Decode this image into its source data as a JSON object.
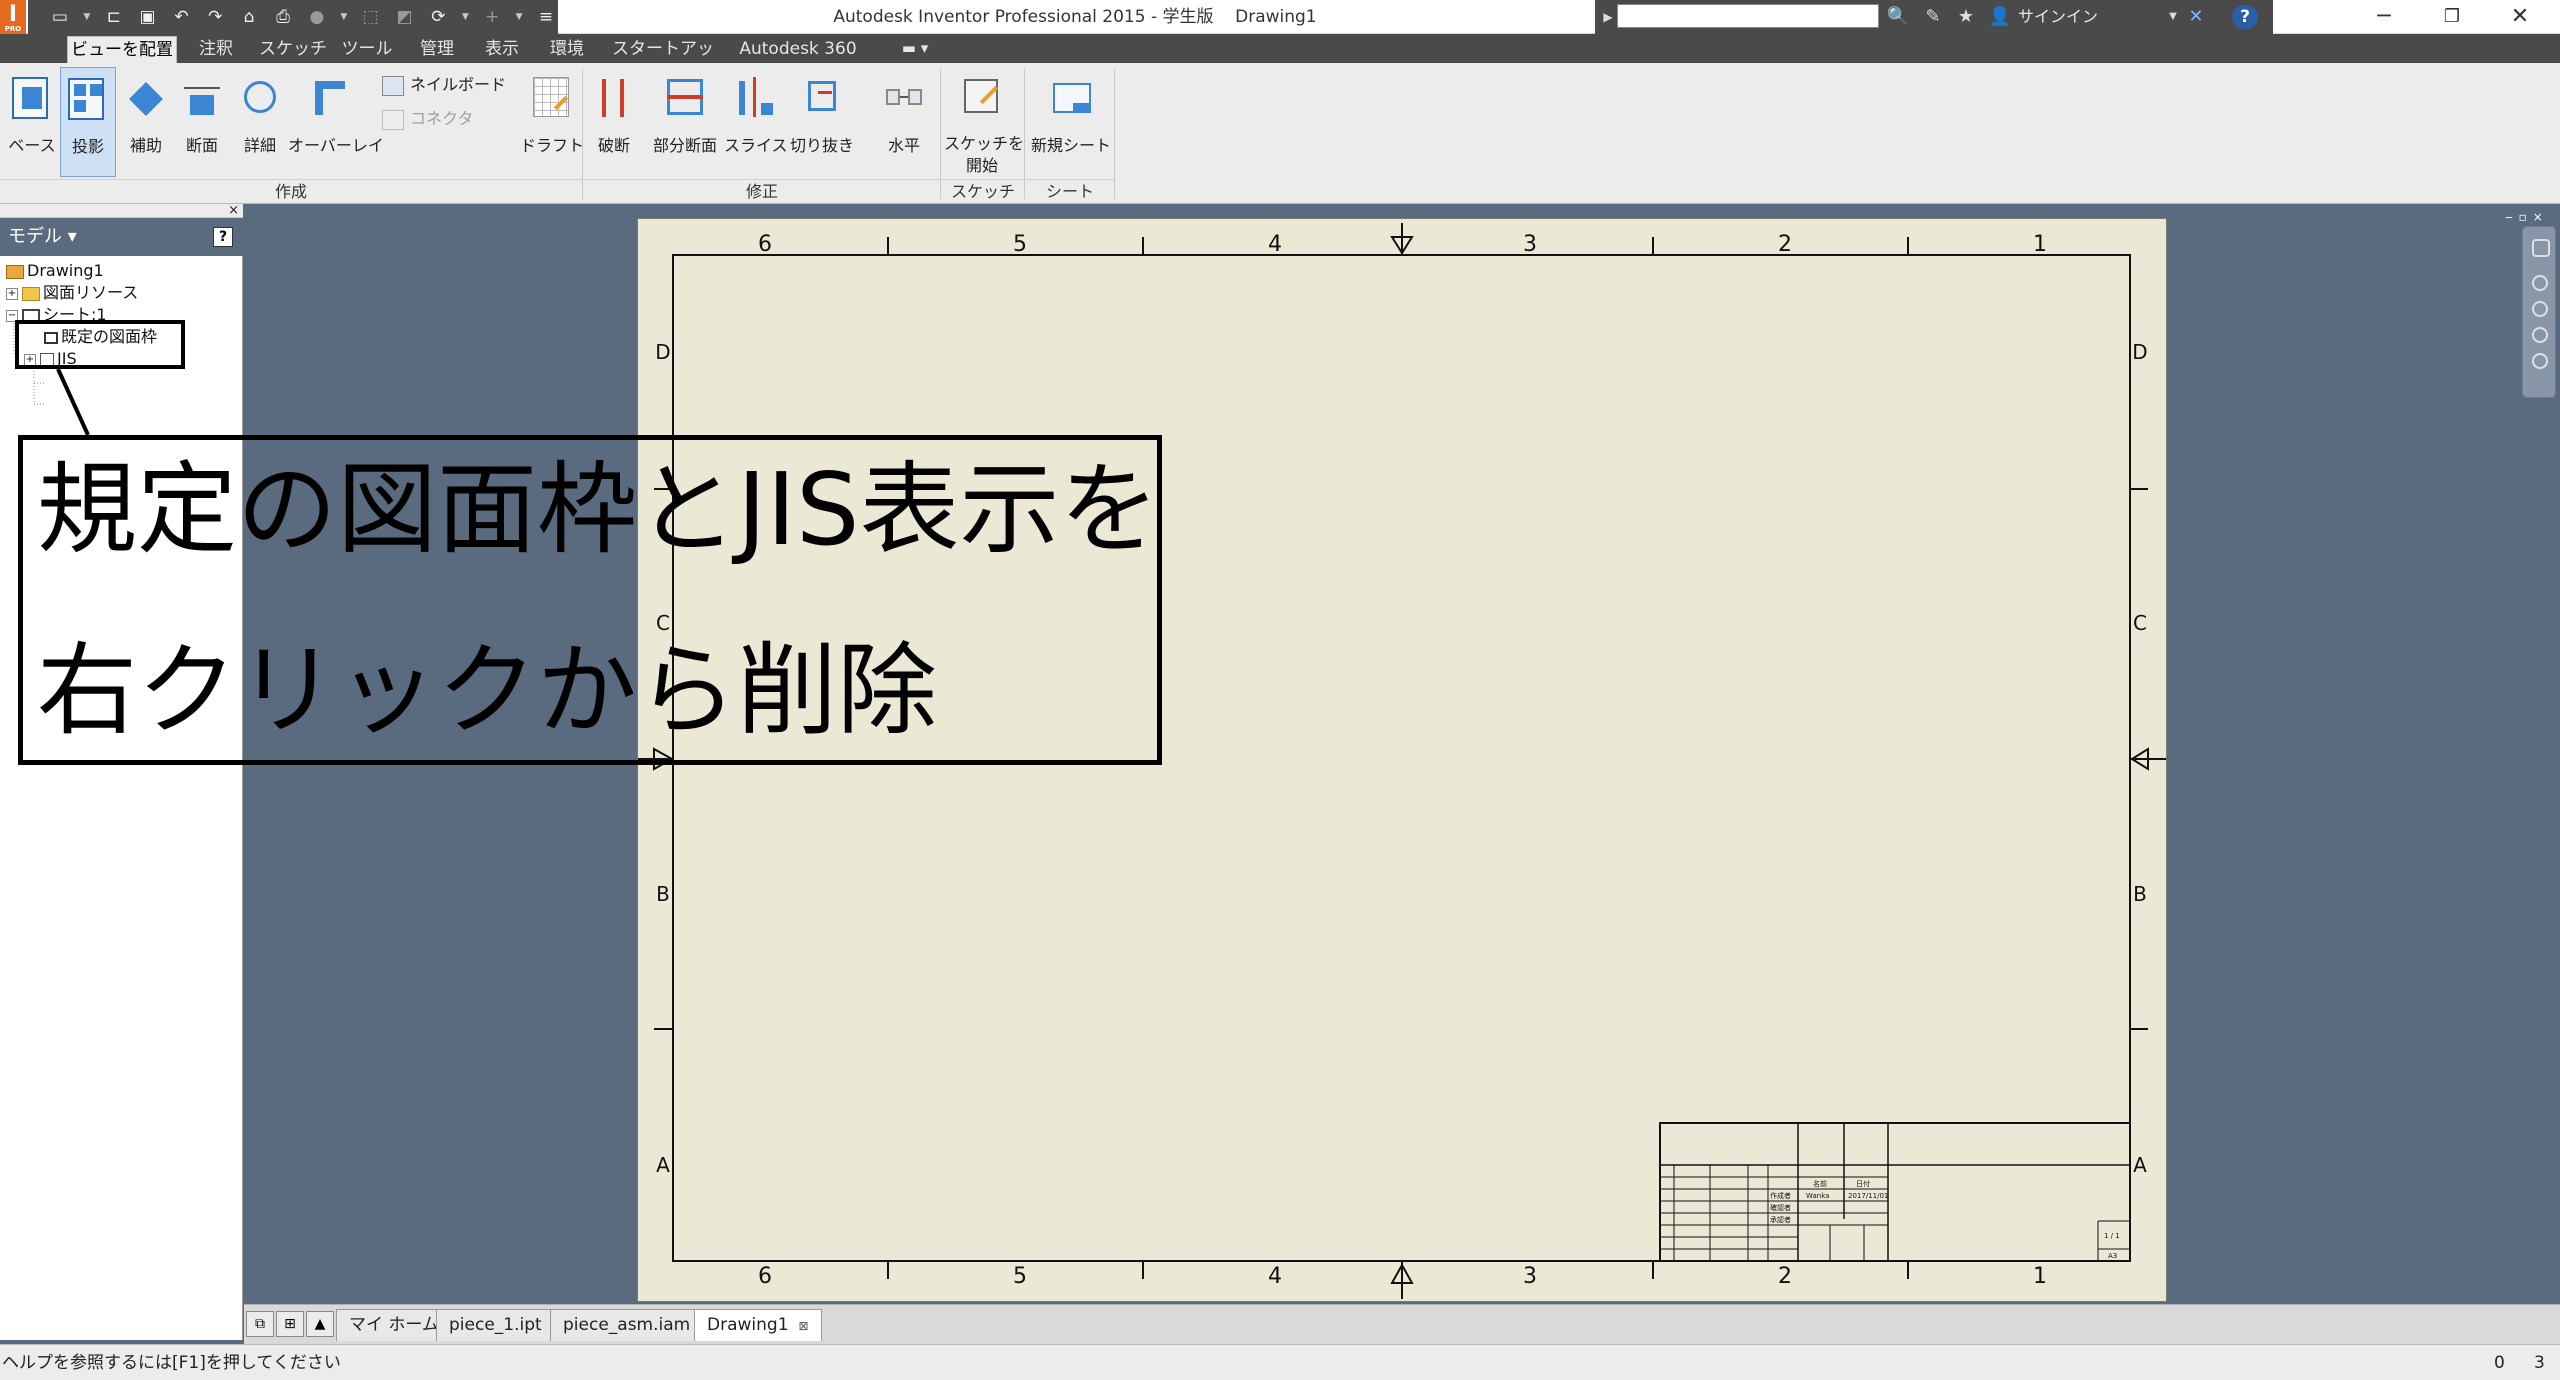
{
  "app": {
    "logo_letter": "I",
    "logo_badge": "PRO",
    "title": "Autodesk Inventor Professional 2015 - 学生版    Drawing1",
    "signin_label": "サインイン"
  },
  "ribbon_tabs": [
    "ビューを配置",
    "注釈",
    "スケッチ",
    "ツール",
    "管理",
    "表示",
    "環境",
    "スタートアップ",
    "Autodesk 360"
  ],
  "ribbon": {
    "create_buttons": [
      "ベース",
      "投影",
      "補助",
      "断面",
      "詳細",
      "オーバーレイ"
    ],
    "small_buttons": [
      "ネイルボード",
      "コネクタ"
    ],
    "draft_label": "ドラフト",
    "modify_buttons": [
      "破断",
      "部分断面",
      "スライス",
      "切り抜き"
    ],
    "align_label": "水平",
    "sketch_label_1": "スケッチを",
    "sketch_label_2": "開始",
    "new_sheet_label": "新規シート",
    "groups": [
      "作成",
      "修正",
      "スケッチ",
      "シート"
    ]
  },
  "browser": {
    "title": "モデル",
    "help_glyph": "?",
    "tree": [
      {
        "label": "Drawing1",
        "expand": ""
      },
      {
        "label": "図面リソース",
        "expand": "+"
      },
      {
        "label": "シート:1",
        "expand": "−"
      },
      {
        "label": "既定の図面枠",
        "expand": ""
      },
      {
        "label": "JIS",
        "expand": "+"
      }
    ]
  },
  "sheet": {
    "column_labels": [
      "6",
      "5",
      "4",
      "3",
      "2",
      "1"
    ],
    "row_labels": [
      "D",
      "C",
      "B",
      "A"
    ],
    "title_block": {
      "header_name": "名前",
      "header_date": "日付",
      "row_author_label": "作成者",
      "row_author_name": "Wanka",
      "row_author_date": "2017/11/01",
      "row_checker_label": "確認者",
      "row_approver_label": "承認者",
      "sheet_number": "1 / 1",
      "size": "A3"
    }
  },
  "doc_tabs": [
    "マイ ホーム",
    "piece_1.ipt",
    "piece_asm.iam",
    "Drawing1"
  ],
  "status": {
    "text": "ヘルプを参照するには[F1]を押してください",
    "num_1": "0",
    "num_2": "3"
  },
  "annotation": {
    "line_1": "規定の図面枠とJIS表示を",
    "line_2": "右クリックから削除"
  }
}
